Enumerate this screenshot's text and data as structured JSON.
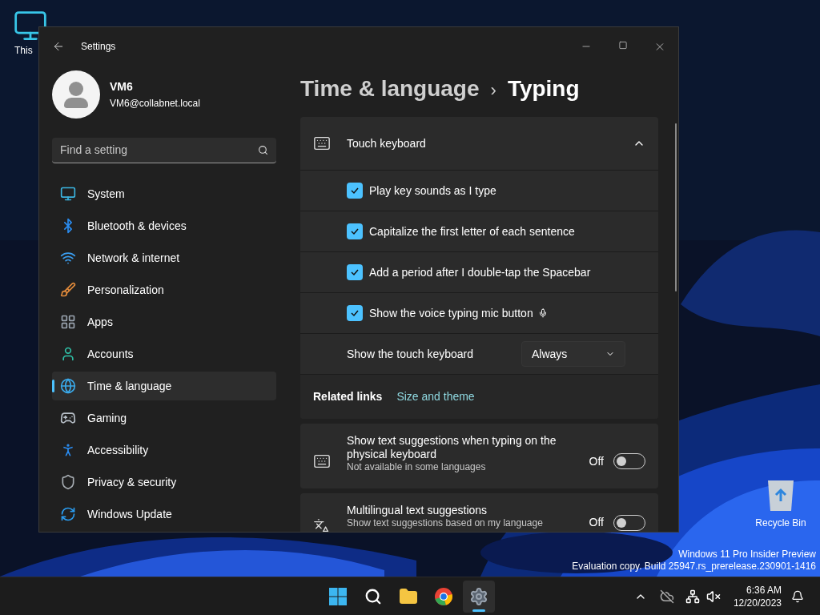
{
  "desktop_icons": [
    {
      "label": "This"
    },
    {
      "label": "Recycle Bin"
    }
  ],
  "window": {
    "title": "Settings"
  },
  "user": {
    "name": "VM6",
    "email": "VM6@collabnet.local"
  },
  "search": {
    "placeholder": "Find a setting"
  },
  "nav": [
    {
      "label": "System",
      "selected": false
    },
    {
      "label": "Bluetooth & devices",
      "selected": false
    },
    {
      "label": "Network & internet",
      "selected": false
    },
    {
      "label": "Personalization",
      "selected": false
    },
    {
      "label": "Apps",
      "selected": false
    },
    {
      "label": "Accounts",
      "selected": false
    },
    {
      "label": "Time & language",
      "selected": true
    },
    {
      "label": "Gaming",
      "selected": false
    },
    {
      "label": "Accessibility",
      "selected": false
    },
    {
      "label": "Privacy & security",
      "selected": false
    },
    {
      "label": "Windows Update",
      "selected": false
    }
  ],
  "breadcrumb": {
    "parent": "Time & language",
    "separator": "›",
    "current": "Typing"
  },
  "touch_keyboard": {
    "title": "Touch keyboard",
    "expanded": true,
    "options": [
      {
        "kind": "checkbox",
        "label": "Play key sounds as I type",
        "checked": true,
        "mic_icon": false
      },
      {
        "kind": "checkbox",
        "label": "Capitalize the first letter of each sentence",
        "checked": true,
        "mic_icon": false
      },
      {
        "kind": "checkbox",
        "label": "Add a period after I double-tap the Spacebar",
        "checked": true,
        "mic_icon": false
      },
      {
        "kind": "checkbox",
        "label": "Show the voice typing mic button",
        "checked": true,
        "mic_icon": true
      },
      {
        "kind": "dropdown",
        "label": "Show the touch keyboard",
        "value": "Always"
      }
    ],
    "related_links": {
      "label": "Related links",
      "links": [
        "Size and theme"
      ]
    }
  },
  "suggestions": [
    {
      "title": "Show text suggestions when typing on the physical keyboard",
      "subtitle": "Not available in some languages",
      "state_label": "Off",
      "on": false
    },
    {
      "title": "Multilingual text suggestions",
      "subtitle": "Show text suggestions based on my language",
      "state_label": "Off",
      "on": false
    }
  ],
  "watermark": [
    "Windows 11 Pro Insider Preview",
    "Evaluation copy. Build 25947.rs_prerelease.230901-1416"
  ],
  "taskbar": {
    "apps": [
      {
        "selected": false
      },
      {
        "selected": false
      },
      {
        "selected": false
      },
      {
        "selected": false
      },
      {
        "selected": true
      }
    ],
    "time": "6:36 AM",
    "date": "12/20/2023"
  }
}
